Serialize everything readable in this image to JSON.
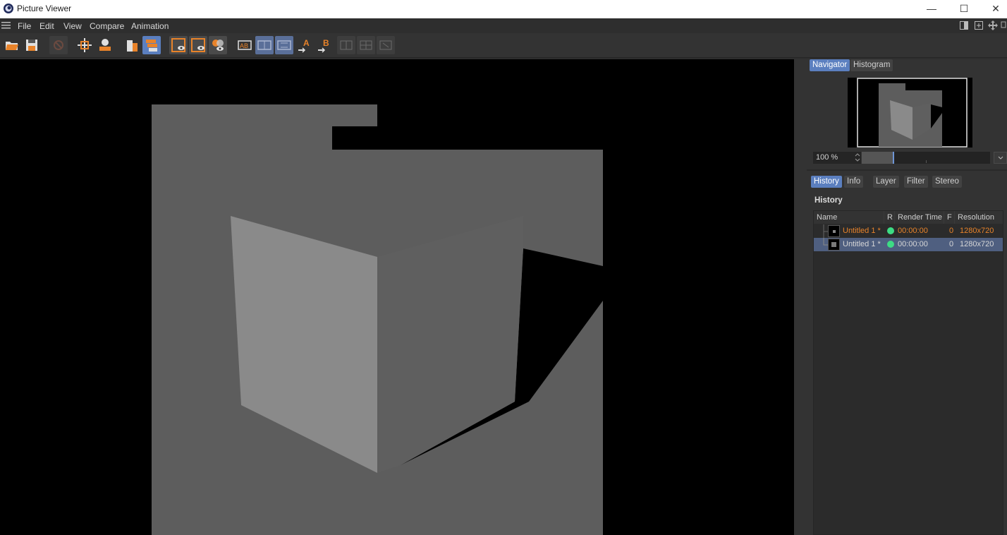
{
  "window": {
    "title": "Picture Viewer"
  },
  "menu": [
    "File",
    "Edit",
    "View",
    "Compare",
    "Animation"
  ],
  "navigator": {
    "tabs": [
      "Navigator",
      "Histogram"
    ],
    "active": "Navigator",
    "zoom": "100 %"
  },
  "history_panel": {
    "tabs": [
      "History",
      "Info",
      "Layer",
      "Filter",
      "Stereo"
    ],
    "active": "History",
    "heading": "History",
    "columns": [
      "Name",
      "R",
      "Render Time",
      "F",
      "Resolution"
    ],
    "rows": [
      {
        "name": "Untitled 1 *",
        "status_color": "#3ddc84",
        "render_time": "00:00:00",
        "frame": "0",
        "resolution": "1280x720",
        "selected": false,
        "highlight": "#e8832a"
      },
      {
        "name": "Untitled 1 *",
        "status_color": "#3ddc84",
        "render_time": "00:00:00",
        "frame": "0",
        "resolution": "1280x720",
        "selected": true,
        "highlight": "#d6d6d6"
      }
    ]
  },
  "colors": {
    "accent": "#5b7fbf",
    "selection": "#4f5f80",
    "orange": "#e8832a",
    "status_ok": "#3ddc84"
  }
}
